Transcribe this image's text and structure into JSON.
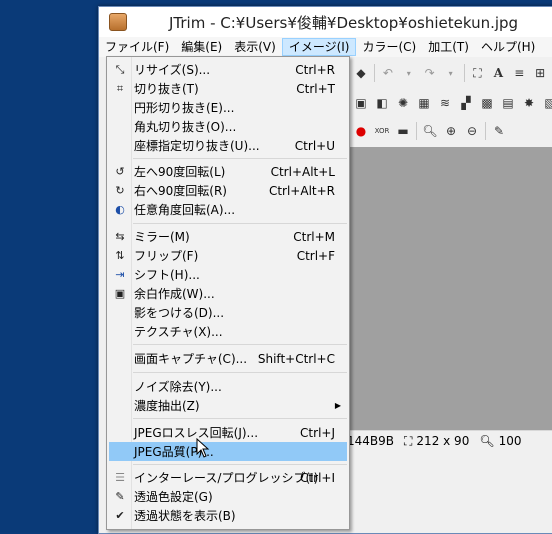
{
  "window": {
    "title": "JTrim - C:¥Users¥俊輔¥Desktop¥oshietekun.jpg"
  },
  "menubar": [
    {
      "label": "ファイル(F)"
    },
    {
      "label": "編集(E)"
    },
    {
      "label": "表示(V)"
    },
    {
      "label": "イメージ(I)"
    },
    {
      "label": "カラー(C)"
    },
    {
      "label": "加工(T)"
    },
    {
      "label": "ヘルプ(H)"
    }
  ],
  "image_menu": {
    "items": [
      {
        "label": "リサイズ(S)...",
        "shortcut": "Ctrl+R",
        "icon": "resize-icon"
      },
      {
        "label": "切り抜き(T)",
        "shortcut": "Ctrl+T",
        "icon": "crop-icon"
      },
      {
        "label": "円形切り抜き(E)...",
        "shortcut": "",
        "icon": ""
      },
      {
        "label": "角丸切り抜き(O)...",
        "shortcut": "",
        "icon": ""
      },
      {
        "label": "座標指定切り抜き(U)...",
        "shortcut": "Ctrl+U",
        "icon": ""
      },
      {
        "label": "左へ90度回転(L)",
        "shortcut": "Ctrl+Alt+L",
        "icon": "rotate-left-icon"
      },
      {
        "label": "右へ90度回転(R)",
        "shortcut": "Ctrl+Alt+R",
        "icon": "rotate-right-icon"
      },
      {
        "label": "任意角度回転(A)...",
        "shortcut": "",
        "icon": "rotate-any-icon"
      },
      {
        "label": "ミラー(M)",
        "shortcut": "Ctrl+M",
        "icon": "mirror-icon"
      },
      {
        "label": "フリップ(F)",
        "shortcut": "Ctrl+F",
        "icon": "flip-icon"
      },
      {
        "label": "シフト(H)...",
        "shortcut": "",
        "icon": "shift-icon"
      },
      {
        "label": "余白作成(W)...",
        "shortcut": "",
        "icon": "margin-icon"
      },
      {
        "label": "影をつける(D)...",
        "shortcut": "",
        "icon": ""
      },
      {
        "label": "テクスチャ(X)...",
        "shortcut": "",
        "icon": ""
      },
      {
        "label": "画面キャプチャ(C)...",
        "shortcut": "Shift+Ctrl+C",
        "icon": ""
      },
      {
        "label": "ノイズ除去(Y)...",
        "shortcut": "",
        "icon": ""
      },
      {
        "label": "濃度抽出(Z)",
        "shortcut": "",
        "icon": ""
      },
      {
        "label": "JPEGロスレス回転(J)...",
        "shortcut": "Ctrl+J",
        "icon": ""
      },
      {
        "label": "JPEG品質(P)...",
        "shortcut": "",
        "icon": ""
      },
      {
        "label": "インターレース/プログレッシブ(I)",
        "shortcut": "Ctrl+I",
        "icon": "interlace-icon"
      },
      {
        "label": "透過色設定(G)",
        "shortcut": "",
        "icon": "eyedropper-icon"
      },
      {
        "label": "透過状態を表示(B)",
        "shortcut": "",
        "icon": "check-icon"
      }
    ],
    "highlighted": "JPEG品質(P)..."
  },
  "status": {
    "color_value": "144B9B",
    "size_value": "212 x 90",
    "zoom_value": "100"
  },
  "colors": {
    "desktop": "#0a3a78",
    "highlight": "#91c9f7",
    "menubar_active": "#cde8ff"
  }
}
